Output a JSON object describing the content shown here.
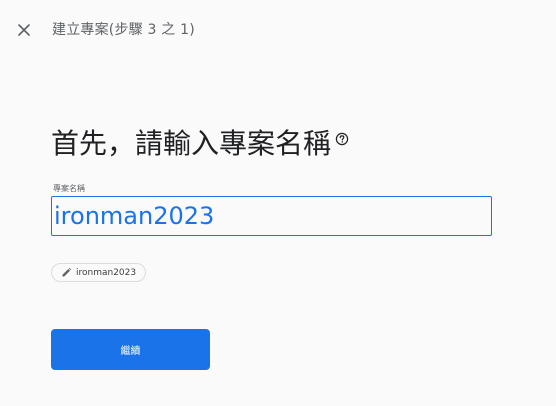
{
  "header": {
    "close_icon": "close-icon",
    "step_title": "建立專案(步驟 3 之 1)"
  },
  "main": {
    "heading": "首先，請輸入專案名稱",
    "help_icon": "help-circle-icon",
    "field": {
      "label": "專案名稱",
      "value": "ironman2023"
    },
    "suggestion_chip": {
      "icon": "pencil-icon",
      "label": "ironman2023"
    },
    "continue_label": "繼續"
  },
  "colors": {
    "accent": "#1a73e8",
    "background": "#fafafa",
    "text_primary": "#202124",
    "text_secondary": "#5f6368"
  }
}
